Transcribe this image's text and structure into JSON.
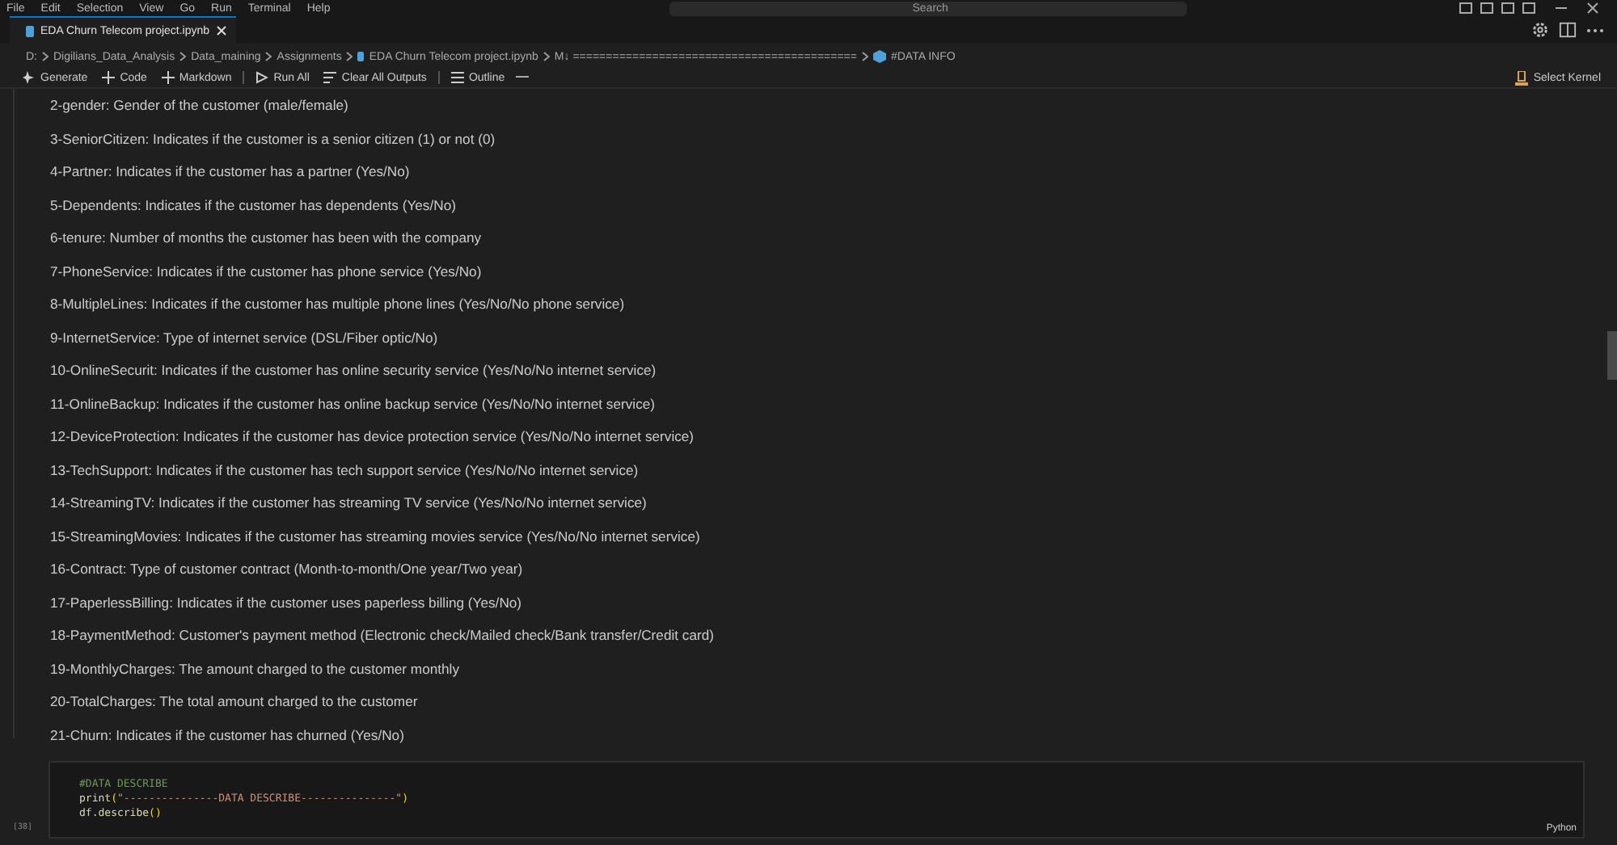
{
  "menu": [
    "File",
    "Edit",
    "Selection",
    "View",
    "Go",
    "Run",
    "Terminal",
    "Help"
  ],
  "search": {
    "placeholder": "Search"
  },
  "tabs": [
    {
      "label": "EDA Churn Telecom project.ipynb",
      "selected": true
    }
  ],
  "breadcrumbs": [
    "D:",
    "Digilians_Data_Analysis",
    "Data_maining",
    "Assignments",
    "EDA Churn Telecom project.ipynb",
    "M↓ ===========================================",
    "#DATA INFO"
  ],
  "toolbar": [
    "Generate",
    "Code",
    "Markdown",
    "Run All",
    "Clear All Outputs",
    "Outline"
  ],
  "kernel": "Select Kernel",
  "markdown_lines": [
    "2-gender: Gender of the customer (male/female)",
    "3-SeniorCitizen: Indicates if the customer is a senior citizen (1) or not (0)",
    "4-Partner: Indicates if the customer has a partner (Yes/No)",
    "5-Dependents: Indicates if the customer has dependents (Yes/No)",
    "6-tenure: Number of months the customer has been with the company",
    "7-PhoneService: Indicates if the customer has phone service (Yes/No)",
    "8-MultipleLines: Indicates if the customer has multiple phone lines (Yes/No/No phone service)",
    "9-InternetService: Type of internet service (DSL/Fiber optic/No)",
    "10-OnlineSecurit: Indicates if the customer has online security service (Yes/No/No internet service)",
    "11-OnlineBackup: Indicates if the customer has online backup service (Yes/No/No internet service)",
    "12-DeviceProtection: Indicates if the customer has device protection service (Yes/No/No internet service)",
    "13-TechSupport: Indicates if the customer has tech support service (Yes/No/No internet service)",
    "14-StreamingTV: Indicates if the customer has streaming TV service (Yes/No/No internet service)",
    "15-StreamingMovies: Indicates if the customer has streaming movies service (Yes/No/No internet service)",
    "16-Contract: Type of customer contract (Month-to-month/One year/Two year)",
    "17-PaperlessBilling: Indicates if the customer uses paperless billing (Yes/No)",
    "18-PaymentMethod: Customer's payment method (Electronic check/Mailed check/Bank transfer/Credit card)",
    "19-MonthlyCharges: The amount charged to the customer monthly",
    "20-TotalCharges: The total amount charged to the customer",
    "21-Churn: Indicates if the customer has churned (Yes/No)"
  ],
  "code_cell": {
    "execution_count": "[38]",
    "language": "Python",
    "lines": [
      [
        {
          "kind": "comment",
          "text": "#DATA DESCRIBE"
        }
      ],
      [
        {
          "kind": "func",
          "text": "print"
        },
        {
          "kind": "paren",
          "text": "("
        },
        {
          "kind": "string",
          "text": "\"---------------DATA DESCRIBE---------------\""
        },
        {
          "kind": "paren",
          "text": ")"
        }
      ],
      [
        {
          "kind": "func",
          "text": "df.describe"
        },
        {
          "kind": "paren",
          "text": "()"
        }
      ]
    ]
  }
}
